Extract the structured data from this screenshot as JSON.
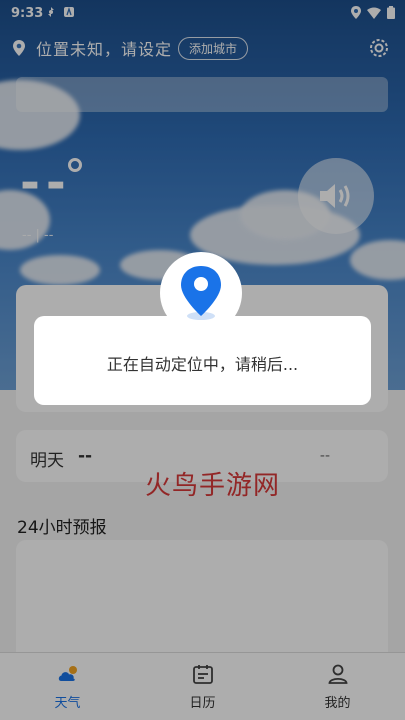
{
  "status_bar": {
    "time": "9:33",
    "left_icons": [
      "sync-icon",
      "notification-a-icon"
    ],
    "right_icons": [
      "location-icon",
      "wifi-icon",
      "battery-icon"
    ]
  },
  "header": {
    "location_text": "位置未知，请设定",
    "add_city_label": "添加城市",
    "location_icon": "pin-icon",
    "settings_icon": "gear-icon"
  },
  "weather": {
    "temperature": "--",
    "sub_info": "-- | --",
    "speaker_icon": "speaker-icon"
  },
  "tomorrow": {
    "label": "明天",
    "value": "--",
    "right_value": "--"
  },
  "hourly": {
    "title": "24小时预报"
  },
  "watermark": "火鸟手游网",
  "dialog": {
    "message": "正在自动定位中，请稍后..."
  },
  "bottom_nav": [
    {
      "label": "天气",
      "icon": "weather-icon",
      "active": true
    },
    {
      "label": "日历",
      "icon": "calendar-icon",
      "active": false
    },
    {
      "label": "我的",
      "icon": "profile-icon",
      "active": false
    }
  ],
  "colors": {
    "accent": "#1a73e8",
    "watermark": "#d62a2a",
    "sky_top": "#1d4f8c"
  }
}
